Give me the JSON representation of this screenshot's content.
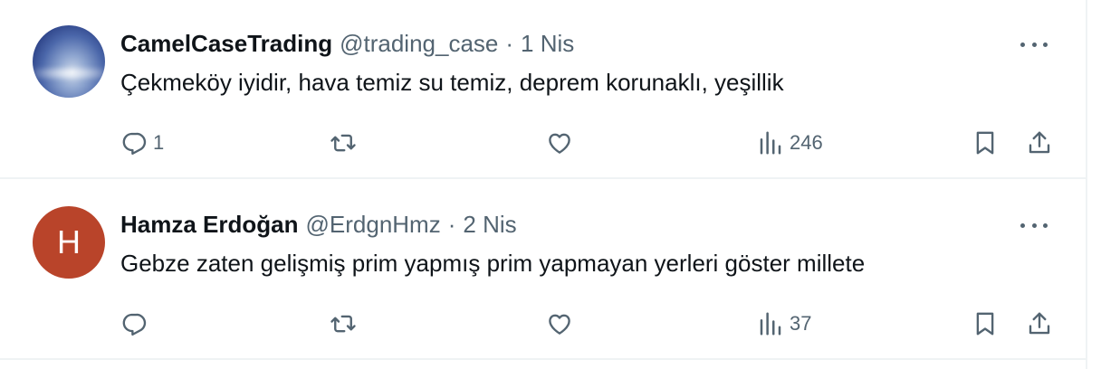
{
  "tweets": [
    {
      "author": {
        "name": "CamelCaseTrading",
        "handle": "@trading_case"
      },
      "separator": "·",
      "date": "1 Nis",
      "text": "Çekmeköy iyidir, hava temiz su temiz, deprem korunaklı, yeşillik",
      "avatar": {
        "type": "photo"
      },
      "stats": {
        "replies": "1",
        "retweets": "",
        "likes": "",
        "views": "246"
      }
    },
    {
      "author": {
        "name": "Hamza Erdoğan",
        "handle": "@ErdgnHmz"
      },
      "separator": "·",
      "date": "2 Nis",
      "text": "Gebze zaten gelişmiş prim yapmış prim yapmayan yerleri göster millete",
      "avatar": {
        "type": "letter",
        "letter": "H",
        "color": "#b9442a"
      },
      "stats": {
        "replies": "",
        "retweets": "",
        "likes": "",
        "views": "37"
      }
    }
  ],
  "icons": {
    "reply": "reply-icon",
    "retweet": "retweet-icon",
    "like": "like-icon",
    "views": "views-icon",
    "bookmark": "bookmark-icon",
    "share": "share-icon",
    "more": "more-icon"
  },
  "colors": {
    "secondary_text": "#536471",
    "primary_text": "#0f1419",
    "divider": "#eff3f4"
  }
}
